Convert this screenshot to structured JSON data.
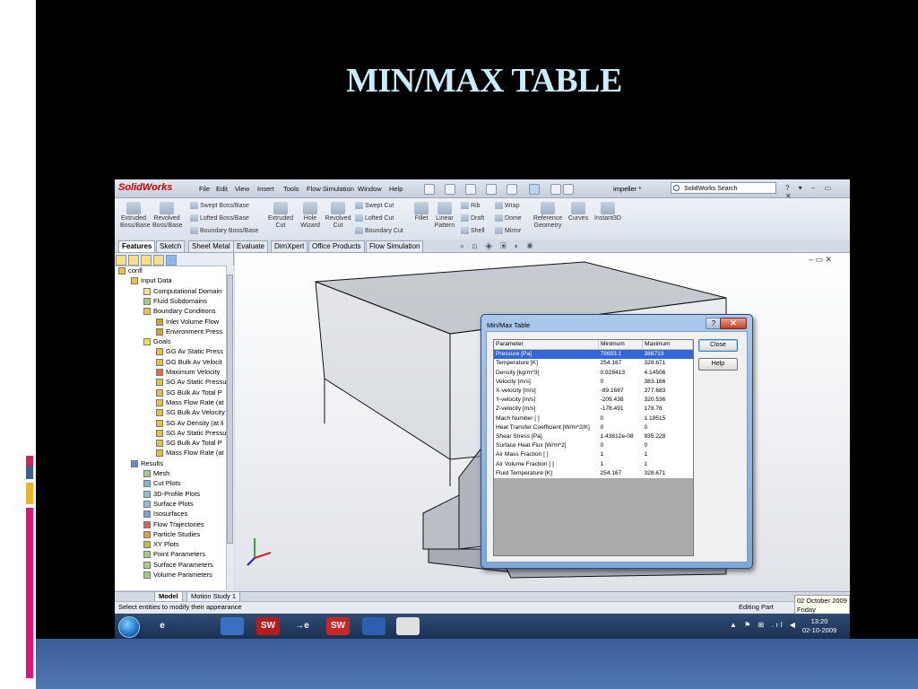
{
  "slide": {
    "title": "MIN/MAX TABLE"
  },
  "app": {
    "logo": "SolidWorks",
    "menu": [
      "File",
      "Edit",
      "View",
      "Insert",
      "Tools",
      "Flow Simulation",
      "Window",
      "Help"
    ],
    "document_name": "impeller *",
    "search_placeholder": "SolidWorks Search",
    "window_buttons": "? ▾ – ▭ ✕"
  },
  "ribbon": {
    "large_buttons": [
      {
        "label": "Extruded\nBoss/Base",
        "icon": "extrude-icon"
      },
      {
        "label": "Revolved\nBoss/Base",
        "icon": "revolve-icon"
      },
      {
        "label": "Extruded\nCut",
        "icon": "extruded-cut-icon"
      },
      {
        "label": "Hole\nWizard",
        "icon": "hole-wizard-icon"
      },
      {
        "label": "Revolved\nCut",
        "icon": "revolved-cut-icon"
      },
      {
        "label": "Fillet",
        "icon": "fillet-icon"
      },
      {
        "label": "Linear\nPattern",
        "icon": "linear-pattern-icon"
      },
      {
        "label": "Reference\nGeometry",
        "icon": "reference-geometry-icon"
      },
      {
        "label": "Curves",
        "icon": "curves-icon"
      },
      {
        "label": "Instant3D",
        "icon": "instant3d-icon"
      }
    ],
    "small_buttons": [
      "Swept Boss/Base",
      "Lofted Boss/Base",
      "Boundary Boss/Base",
      "Swept Cut",
      "Lofted Cut",
      "Boundary Cut",
      "Rib",
      "Draft",
      "Shell",
      "Wrap",
      "Dome",
      "Mirror"
    ]
  },
  "tabs": [
    "Features",
    "Sketch",
    "Sheet Metal",
    "Evaluate",
    "DimXpert",
    "Office Products",
    "Flow Simulation"
  ],
  "tree": {
    "items": [
      "confl",
      "Input Data",
      "Computational Domain",
      "Fluid Subdomains",
      "Boundary Conditions",
      "Inlet Volume Flow",
      "Environment Press",
      "Goals",
      "GG Av Static Press",
      "GG Bulk Av Velocit",
      "Maximum Velocity",
      "SG Av Static Pressu",
      "SG Bulk Av Total P",
      "Mass Flow Rate (at",
      "SG Bulk Av Velocity",
      "SG Av Density (at li",
      "SG Av Static Pressu",
      "SG Bulk Av Total P",
      "Mass Flow Rate (at",
      "Results",
      "Mesh",
      "Cut Plots",
      "3D-Profile Plots",
      "Surface Plots",
      "Isosurfaces",
      "Flow Trajectories",
      "Particle Studies",
      "XY Plots",
      "Point Parameters",
      "Surface Parameters",
      "Volume Parameters"
    ]
  },
  "bottom_tabs": [
    "Model",
    "Motion Study 1"
  ],
  "status": {
    "message": "Select entities to modify their appearance",
    "mode": "Editing Part"
  },
  "date_tooltip": {
    "line1": "02 October 2009",
    "line2": "Friday"
  },
  "taskbar": {
    "apps": [
      {
        "icon": "internet-explorer-icon",
        "text": "e"
      },
      {
        "icon": "explorer-folder-icon",
        "text": ""
      },
      {
        "icon": "media-player-icon",
        "text": ""
      },
      {
        "icon": "solidworks-icon",
        "text": "SW"
      },
      {
        "icon": "ie-arrow-icon",
        "text": "→e"
      },
      {
        "icon": "solidworks-active-icon",
        "text": "SW"
      },
      {
        "icon": "paint-icon",
        "text": ""
      },
      {
        "icon": "pattern-app-icon",
        "text": ""
      }
    ],
    "tray": "▲ ⚑ ⊞ .ıl ◀",
    "clock_time": "13:20",
    "clock_date": "02-10-2009"
  },
  "dialog": {
    "title": "Min/Max Table",
    "help_glyph": "?",
    "close_glyph": "✕",
    "columns": [
      "Parameter",
      "Minimum",
      "Maximum"
    ],
    "rows": [
      [
        "Pressure [Pa]",
        "79693.1",
        "388719"
      ],
      [
        "Temperature [K]",
        "254.167",
        "328.671"
      ],
      [
        "Density [kg/m^3]",
        "0.928413",
        "4.14506"
      ],
      [
        "Velocity [m/s]",
        "0",
        "383.166"
      ],
      [
        "X-velocity [m/s]",
        "-89.1687",
        "377.683"
      ],
      [
        "Y-velocity [m/s]",
        "-209.438",
        "320.536"
      ],
      [
        "Z-velocity [m/s]",
        "-178.491",
        "178.76"
      ],
      [
        "Mach Number [ ]",
        "0",
        "1.19515"
      ],
      [
        "Heat Transfer Coefficient [W/m^2/K]",
        "0",
        "0"
      ],
      [
        "Shear Stress [Pa]",
        "1.43812e-08",
        "935.228"
      ],
      [
        "Surface Heat Flux [W/m^2]",
        "0",
        "0"
      ],
      [
        "Air Mass Fraction [ ]",
        "1",
        "1"
      ],
      [
        "Air Volume Fraction [ ]",
        "1",
        "1"
      ],
      [
        "Fluid Temperature [K]",
        "254.167",
        "328.671"
      ]
    ],
    "buttons": {
      "close": "Close",
      "help": "Help"
    }
  }
}
